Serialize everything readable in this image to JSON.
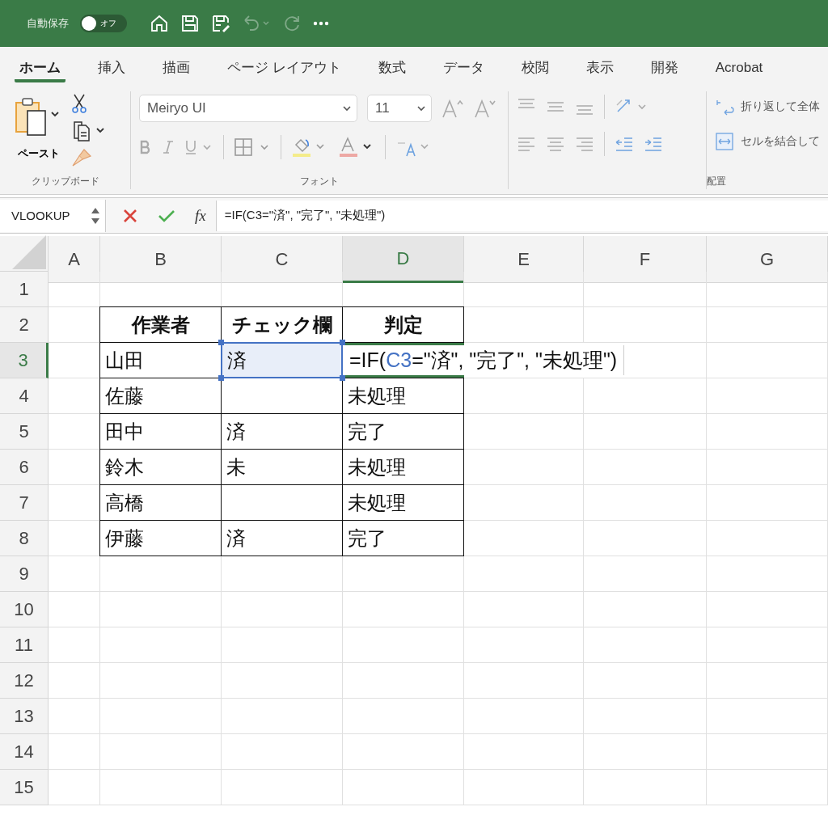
{
  "quick_access": {
    "autosave_label": "自動保存",
    "autosave_toggle": {
      "label": "オフ",
      "on": false
    }
  },
  "tabs": [
    {
      "label": "ホーム",
      "selected": true
    },
    {
      "label": "挿入",
      "selected": false
    },
    {
      "label": "描画",
      "selected": false
    },
    {
      "label": "ページ レイアウト",
      "selected": false
    },
    {
      "label": "数式",
      "selected": false
    },
    {
      "label": "データ",
      "selected": false
    },
    {
      "label": "校閲",
      "selected": false
    },
    {
      "label": "表示",
      "selected": false
    },
    {
      "label": "開発",
      "selected": false
    },
    {
      "label": "Acrobat",
      "selected": false
    }
  ],
  "ribbon": {
    "clipboard": {
      "paste_label": "ペースト",
      "group_label": "クリップボード"
    },
    "font": {
      "font_name": "Meiryo UI",
      "font_size": "11",
      "group_label": "フォント"
    },
    "alignment": {
      "wrap_text": "折り返して全体",
      "merge": "セルを結合して",
      "group_label": "配置"
    }
  },
  "formula_bar": {
    "name_box": "VLOOKUP",
    "function_label": "fx",
    "formula": "=IF(C3=\"済\", \"完了\", \"未処理\")"
  },
  "sheet": {
    "columns": [
      {
        "label": "A",
        "selected": false
      },
      {
        "label": "B",
        "selected": false
      },
      {
        "label": "C",
        "selected": false
      },
      {
        "label": "D",
        "selected": true
      },
      {
        "label": "E",
        "selected": false
      },
      {
        "label": "F",
        "selected": false
      },
      {
        "label": "G",
        "selected": false
      }
    ],
    "row_headers": [
      {
        "label": "1",
        "selected": false
      },
      {
        "label": "2",
        "selected": false
      },
      {
        "label": "3",
        "selected": true
      },
      {
        "label": "4",
        "selected": false
      },
      {
        "label": "5",
        "selected": false
      },
      {
        "label": "6",
        "selected": false
      },
      {
        "label": "7",
        "selected": false
      },
      {
        "label": "8",
        "selected": false
      },
      {
        "label": "9",
        "selected": false
      },
      {
        "label": "10",
        "selected": false
      },
      {
        "label": "11",
        "selected": false
      },
      {
        "label": "12",
        "selected": false
      },
      {
        "label": "13",
        "selected": false
      },
      {
        "label": "14",
        "selected": false
      },
      {
        "label": "15",
        "selected": false
      }
    ],
    "table": {
      "header": [
        "作業者",
        "チェック欄",
        "判定"
      ],
      "rows": [
        {
          "worker": "山田",
          "check": "済",
          "check_referenced": true,
          "judgement_formula": [
            {
              "text": "=IF(",
              "reference": false
            },
            {
              "text": "C3",
              "reference": true
            },
            {
              "text": "=\"済\", \"完了\", \"未処理\")",
              "reference": false
            }
          ]
        },
        {
          "worker": "佐藤",
          "check_referenced": false,
          "judgement": "未処理"
        },
        {
          "worker": "田中",
          "check": "済",
          "check_referenced": false,
          "judgement": "完了"
        },
        {
          "worker": "鈴木",
          "check": "未",
          "check_referenced": false,
          "judgement": "未処理"
        },
        {
          "worker": "高橋",
          "check_referenced": false,
          "judgement": "未処理"
        },
        {
          "worker": "伊藤",
          "check": "済",
          "check_referenced": false,
          "judgement": "完了"
        }
      ]
    }
  }
}
